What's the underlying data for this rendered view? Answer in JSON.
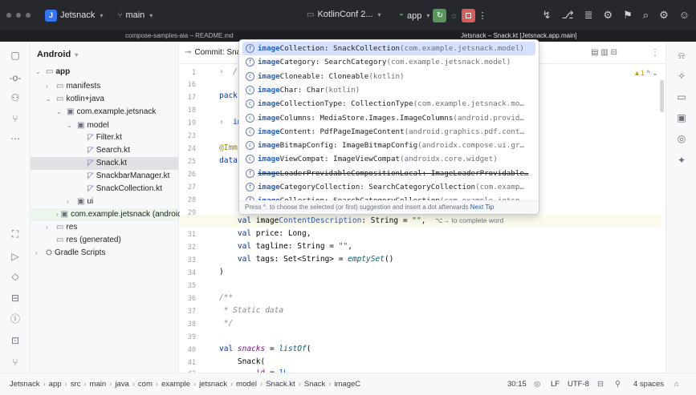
{
  "titlebar": {
    "project_badge": "J",
    "project": "Jetsnack",
    "branch": "main",
    "device": "KotlinConf 2...",
    "run_config": "app"
  },
  "tabs": {
    "left": "compose-samples-aia – README.md",
    "right": "Jetsnack – Snack.kt [Jetsnack.app.main]"
  },
  "project_panel": {
    "title": "Android",
    "rows": [
      {
        "label": "app",
        "ind": 0
      },
      {
        "label": "manifests",
        "ind": 1
      },
      {
        "label": "kotlin+java",
        "ind": 1
      },
      {
        "label": "com.example.jetsnack",
        "ind": 2
      },
      {
        "label": "model",
        "ind": 3
      },
      {
        "label": "Filter.kt",
        "ind": 4
      },
      {
        "label": "Search.kt",
        "ind": 4
      },
      {
        "label": "Snack.kt",
        "ind": 4
      },
      {
        "label": "SnackbarManager.kt",
        "ind": 4
      },
      {
        "label": "SnackCollection.kt",
        "ind": 4
      },
      {
        "label": "ui",
        "ind": 3
      },
      {
        "label": "com.example.jetsnack (androidTest)",
        "ind": 2
      },
      {
        "label": "res",
        "ind": 1
      },
      {
        "label": "res (generated)",
        "ind": 1
      },
      {
        "label": "Gradle Scripts",
        "ind": 0
      }
    ]
  },
  "editor": {
    "tab_label": "Commit: Sna",
    "warn_count": "1",
    "lines": [
      "1",
      "16",
      "17",
      "18",
      "19",
      "23",
      "24",
      "25",
      "26",
      "27",
      "28",
      "29",
      "30",
      "31",
      "32",
      "33",
      "34",
      "35",
      "36",
      "37",
      "38",
      "39",
      "40",
      "41",
      "42"
    ]
  },
  "popup": {
    "items": [
      {
        "name": "imageCollection",
        "type": ": SnackCollection",
        "pkg": "(com.example.jetsnack.model)"
      },
      {
        "name": "imageCategory",
        "type": ": SearchCategory",
        "pkg": "(com.example.jetsnack.model)"
      },
      {
        "name": "imageCloneable",
        "type": ": Cloneable",
        "pkg": "(kotlin)"
      },
      {
        "name": "imageChar",
        "type": ": Char",
        "pkg": "(kotlin)"
      },
      {
        "name": "imageCollectionType",
        "type": ": CollectionType",
        "pkg": "(com.example.jetsnack.mo…"
      },
      {
        "name": "imageColumns",
        "type": ": MediaStore.Images.ImageColumns",
        "pkg": "(android.provid…"
      },
      {
        "name": "imageContent",
        "type": ": PdfPageImageContent",
        "pkg": "(android.graphics.pdf.cont…"
      },
      {
        "name": "imageBitmapConfig",
        "type": ": ImageBitmapConfig",
        "pkg": "(androidx.compose.ui.gr…"
      },
      {
        "name": "imageViewCompat",
        "type": ": ImageViewCompat",
        "pkg": "(androidx.core.widget)"
      },
      {
        "name": "imageLoaderProvidableCompositionLocal",
        "type": ": ImageLoaderProvidable…",
        "pkg": ""
      },
      {
        "name": "imageCategoryCollection",
        "type": ": SearchCategoryCollection",
        "pkg": "(com.examp…"
      },
      {
        "name": "imageCollection",
        "type": ": SearchCategoryCollection",
        "pkg": "(com.example.jetsn…"
      }
    ],
    "footer": "Press ^. to choose the selected (or first) suggestion and insert a dot afterwards",
    "next_tip": "Next Tip"
  },
  "statusbar": {
    "crumbs": [
      "Jetsnack",
      "app",
      "src",
      "main",
      "java",
      "com",
      "example",
      "jetsnack",
      "model",
      "Snack.kt",
      "Snack",
      "imageC"
    ],
    "position": "30:15",
    "line_sep": "LF",
    "encoding": "UTF-8",
    "indent": "4 spaces"
  }
}
